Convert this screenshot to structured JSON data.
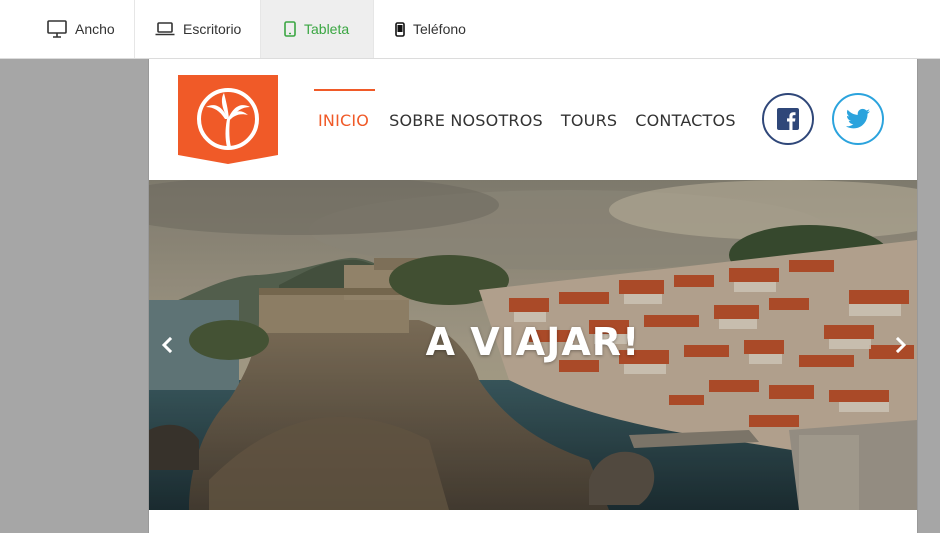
{
  "toolbar": {
    "devices": [
      {
        "label": "Ancho",
        "icon": "monitor-icon"
      },
      {
        "label": "Escritorio",
        "icon": "laptop-icon"
      },
      {
        "label": "Tableta",
        "icon": "tablet-icon",
        "active": true
      },
      {
        "label": "Teléfono",
        "icon": "phone-icon"
      }
    ]
  },
  "site": {
    "logo_icon": "palm-tree-icon",
    "nav": [
      "INICIO",
      "SOBRE NOSOTROS",
      "TOURS",
      "CONTACTOS"
    ],
    "active_nav": "INICIO",
    "social": [
      {
        "name": "facebook",
        "icon": "facebook-icon",
        "color": "#2f4779"
      },
      {
        "name": "twitter",
        "icon": "twitter-icon",
        "color": "#2ba3dd"
      }
    ]
  },
  "hero": {
    "title": "A VIAJAR!",
    "prev_icon": "chevron-left-icon",
    "next_icon": "chevron-right-icon"
  },
  "colors": {
    "accent": "#f05a28",
    "active_device": "#3aa642"
  }
}
